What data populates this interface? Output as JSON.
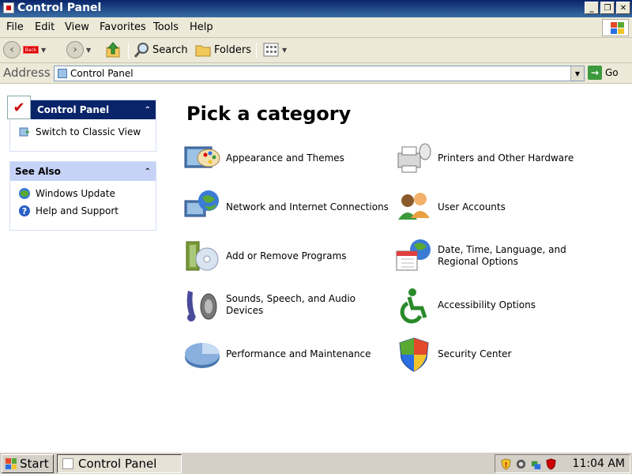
{
  "window": {
    "title": "Control Panel"
  },
  "menus": [
    "File",
    "Edit",
    "View",
    "Favorites",
    "Tools",
    "Help"
  ],
  "toolbar": {
    "back_label": "Back",
    "search_label": "Search",
    "folders_label": "Folders"
  },
  "address": {
    "label": "Address",
    "value": "Control Panel",
    "go_label": "Go"
  },
  "sidebar": {
    "control_panel": {
      "title": "Control Panel",
      "link": "Switch to Classic View"
    },
    "see_also": {
      "title": "See Also",
      "links": [
        "Windows Update",
        "Help and Support"
      ]
    }
  },
  "main": {
    "heading": "Pick a category",
    "categories": [
      {
        "label": "Appearance and Themes",
        "icon": "appearance-icon"
      },
      {
        "label": "Printers and Other Hardware",
        "icon": "printer-icon"
      },
      {
        "label": "Network and Internet Connections",
        "icon": "network-icon"
      },
      {
        "label": "User Accounts",
        "icon": "users-icon"
      },
      {
        "label": "Add or Remove Programs",
        "icon": "programs-icon"
      },
      {
        "label": "Date, Time, Language, and Regional Options",
        "icon": "datetime-icon"
      },
      {
        "label": "Sounds, Speech, and Audio Devices",
        "icon": "sound-icon"
      },
      {
        "label": "Accessibility Options",
        "icon": "accessibility-icon"
      },
      {
        "label": "Performance and Maintenance",
        "icon": "performance-icon"
      },
      {
        "label": "Security Center",
        "icon": "security-shield-icon"
      }
    ]
  },
  "taskbar": {
    "start_label": "Start",
    "task_label": "Control Panel",
    "clock": "11:04 AM"
  },
  "colors": {
    "titlebar": "#0a246a",
    "panel_header": "#0a246a",
    "link_text": "#000000",
    "accent_green": "#3c9a3c"
  }
}
